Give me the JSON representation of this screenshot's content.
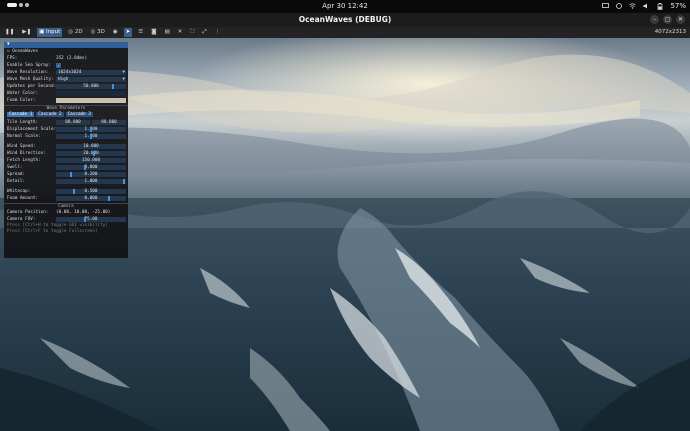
{
  "system": {
    "clock": "Apr 30  12:42",
    "battery": "57%"
  },
  "window": {
    "title": "OceanWaves (DEBUG)",
    "minimize": "–",
    "maximize": "▢",
    "close": "✕"
  },
  "toolbar": {
    "input": "Input",
    "mode2d": "2D",
    "mode3d": "3D",
    "resolution": "4072x2313"
  },
  "panel": {
    "title": "OceanWaves",
    "fps_label": "FPS:",
    "fps_value": "352 (2.84ms)",
    "sea_spray_label": "Enable Sea Spray:",
    "sea_spray_check": "✓",
    "wave_res_label": "Wave Resolution:",
    "wave_res_value": "1024x1024",
    "mesh_quality_label": "Wave Mesh Quality:",
    "mesh_quality_value": "High",
    "updates_label": "Updates per Second:",
    "updates_value": "50.000",
    "water_color_label": "Water Color:",
    "foam_color_label": "Foam Color:",
    "wave_params_header": "Wave Parameters",
    "cascades": [
      "Cascade 1",
      "Cascade 2",
      "Cascade 3"
    ],
    "tile_length_label": "Tile Length:",
    "tile_length_x": "88.000",
    "tile_length_y": "88.000",
    "displacement_label": "Displacement Scale:",
    "displacement_value": "1.000",
    "normal_label": "Normal Scale:",
    "normal_value": "1.000",
    "wind_speed_label": "Wind Speed:",
    "wind_speed_value": "10.000",
    "wind_dir_label": "Wind Direction:",
    "wind_dir_value": "20.000",
    "fetch_label": "Fetch Length:",
    "fetch_value": "150.000",
    "swell_label": "Swell:",
    "swell_value": "0.800",
    "spread_label": "Spread:",
    "spread_value": "0.200",
    "detail_label": "Detail:",
    "detail_value": "1.000",
    "whitecap_label": "Whitecap:",
    "whitecap_value": "0.500",
    "foam_amount_label": "Foam Amount:",
    "foam_amount_value": "0.000",
    "camera_header": "Camera",
    "cam_pos_label": "Camera Position:",
    "cam_pos_value": "(0.00, 10.00, -25.00)",
    "cam_fov_label": "Camera FOV:",
    "cam_fov_value": "75.00",
    "hint1": "Press [Ctrl+H to toggle GUI visibility]",
    "hint2": "Press [Ctrl+F to toggle Fullscreen]",
    "colors": {
      "water": "#1a2a3a",
      "foam": "#c9c0b0"
    }
  }
}
